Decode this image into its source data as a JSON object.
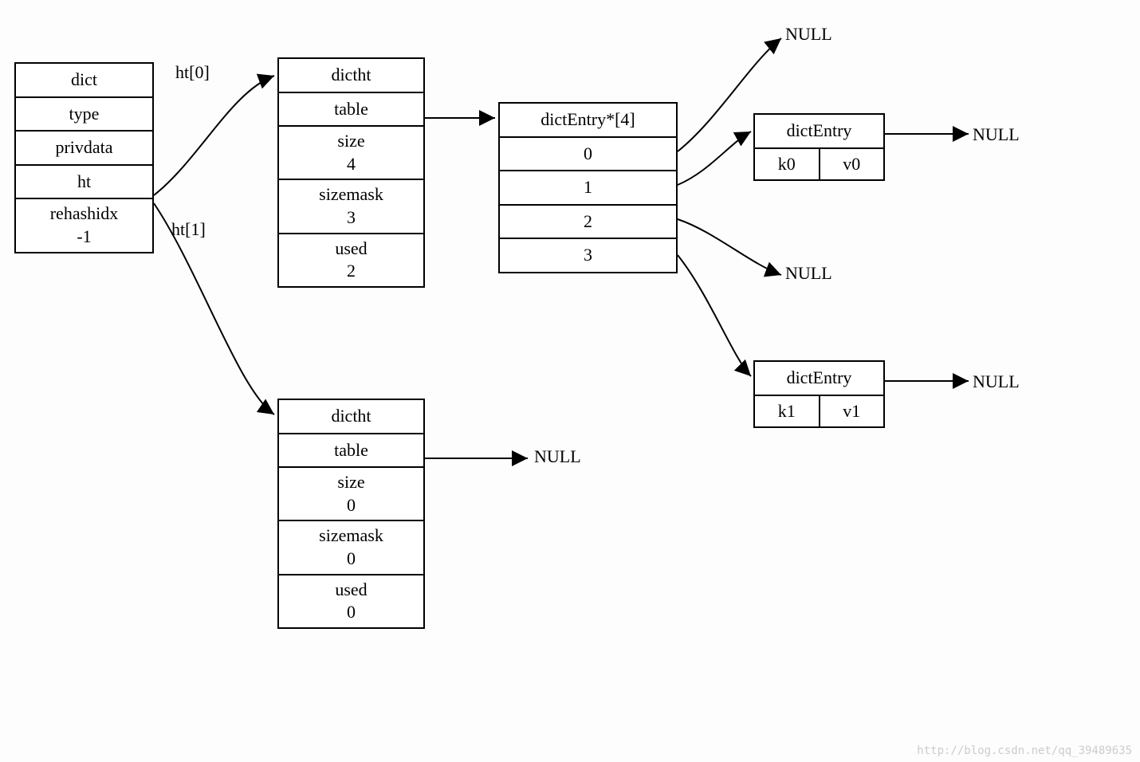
{
  "dict": {
    "title": "dict",
    "fields": [
      "type",
      "privdata",
      "ht"
    ],
    "rehash_label": "rehashidx",
    "rehash_value": "-1"
  },
  "ht_labels": {
    "ht0": "ht[0]",
    "ht1": "ht[1]"
  },
  "dictht0": {
    "title": "dictht",
    "table": "table",
    "size_label": "size",
    "size_value": "4",
    "mask_label": "sizemask",
    "mask_value": "3",
    "used_label": "used",
    "used_value": "2"
  },
  "dictht1": {
    "title": "dictht",
    "table": "table",
    "size_label": "size",
    "size_value": "0",
    "mask_label": "sizemask",
    "mask_value": "0",
    "used_label": "used",
    "used_value": "0"
  },
  "entry_array": {
    "title": "dictEntry*[4]",
    "slots": [
      "0",
      "1",
      "2",
      "3"
    ]
  },
  "entry0": {
    "title": "dictEntry",
    "k": "k0",
    "v": "v0"
  },
  "entry1": {
    "title": "dictEntry",
    "k": "k1",
    "v": "v1"
  },
  "nulls": {
    "n_top": "NULL",
    "n_slot2": "NULL",
    "n_e0": "NULL",
    "n_e1": "NULL",
    "n_ht1": "NULL"
  },
  "watermark": "http://blog.csdn.net/qq_39489635"
}
